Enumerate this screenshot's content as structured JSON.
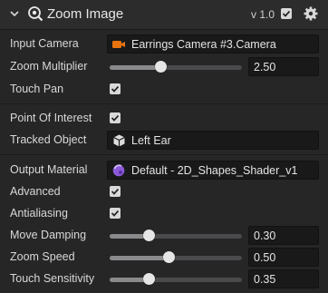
{
  "header": {
    "title": "Zoom Image",
    "version": "v 1.0",
    "enabled": true,
    "icons": {
      "collapse": "chevron-down-icon",
      "component": "zoom-magnifier-icon",
      "settings": "gear-icon"
    }
  },
  "fields": {
    "input_camera": {
      "label": "Input Camera",
      "value": "Earrings Camera #3.Camera",
      "icon": "camera-icon",
      "icon_color": "#e8730f"
    },
    "zoom_multiplier": {
      "label": "Zoom Multiplier",
      "value": "2.50",
      "level": 0.39
    },
    "touch_pan": {
      "label": "Touch Pan",
      "checked": true
    },
    "point_of_interest": {
      "label": "Point Of Interest",
      "checked": true
    },
    "tracked_object": {
      "label": "Tracked Object",
      "value": "Left Ear",
      "icon": "cube-object-icon"
    },
    "output_material": {
      "label": "Output Material",
      "value": "Default - 2D_Shapes_Shader_v1",
      "icon": "material-icon",
      "icon_color": "#8c5ad8"
    },
    "advanced": {
      "label": "Advanced",
      "checked": true
    },
    "antialiasing": {
      "label": "Antialiasing",
      "checked": true
    },
    "move_damping": {
      "label": "Move Damping",
      "value": "0.30",
      "level": 0.3
    },
    "zoom_speed": {
      "label": "Zoom Speed",
      "value": "0.50",
      "level": 0.45
    },
    "touch_sensitivity": {
      "label": "Touch Sensitivity",
      "value": "0.35",
      "level": 0.3
    }
  },
  "colors": {
    "accent_orange": "#e8730f",
    "accent_purple": "#8c5ad8",
    "panel": "#262627",
    "field": "#19191a"
  }
}
